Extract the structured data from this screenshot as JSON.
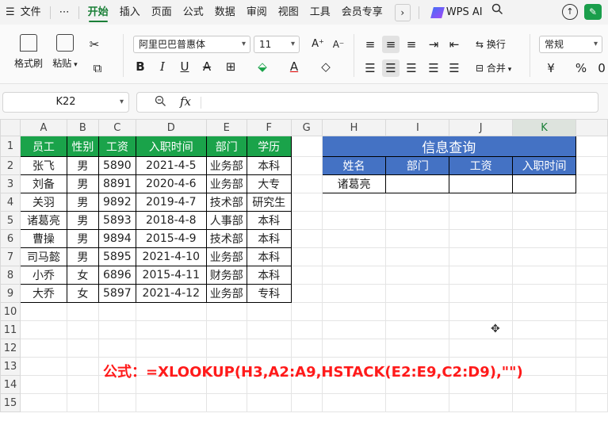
{
  "menu": {
    "hamburger": "☰",
    "file": "文件",
    "more": "⋯",
    "tabs": [
      "开始",
      "插入",
      "页面",
      "公式",
      "数据",
      "审阅",
      "视图",
      "工具",
      "会员专享"
    ],
    "active_tab": "开始",
    "chevron": "›",
    "wps_ai": "WPS AI"
  },
  "ribbon": {
    "format_painter": "格式刷",
    "paste": "粘贴",
    "font_name": "阿里巴巴普惠体",
    "font_size": "11",
    "bold": "B",
    "italic": "I",
    "underline": "U",
    "wrap": "换行",
    "merge": "合并",
    "number_format": "常规",
    "currency": "¥",
    "percent": "%"
  },
  "formula_bar": {
    "cell_ref": "K22",
    "fx": "fx",
    "content": ""
  },
  "sheet": {
    "columns": [
      "A",
      "B",
      "C",
      "D",
      "E",
      "F",
      "G",
      "H",
      "I",
      "J",
      "K"
    ],
    "selected_column": "K",
    "rows": [
      "1",
      "2",
      "3",
      "4",
      "5",
      "6",
      "7",
      "8",
      "9",
      "10",
      "11",
      "12",
      "13",
      "14",
      "15"
    ],
    "employee_headers": [
      "员工",
      "性别",
      "工资",
      "入职时间",
      "部门",
      "学历"
    ],
    "employees": [
      [
        "张飞",
        "男",
        "5890",
        "2021-4-5",
        "业务部",
        "本科"
      ],
      [
        "刘备",
        "男",
        "8891",
        "2020-4-6",
        "业务部",
        "大专"
      ],
      [
        "关羽",
        "男",
        "9892",
        "2019-4-7",
        "技术部",
        "研究生"
      ],
      [
        "诸葛亮",
        "男",
        "5893",
        "2018-4-8",
        "人事部",
        "本科"
      ],
      [
        "曹操",
        "男",
        "9894",
        "2015-4-9",
        "技术部",
        "本科"
      ],
      [
        "司马懿",
        "男",
        "5895",
        "2021-4-10",
        "业务部",
        "本科"
      ],
      [
        "小乔",
        "女",
        "6896",
        "2015-4-11",
        "财务部",
        "本科"
      ],
      [
        "大乔",
        "女",
        "5897",
        "2021-4-12",
        "业务部",
        "专科"
      ]
    ],
    "query_title": "信息查询",
    "query_headers": [
      "姓名",
      "部门",
      "工资",
      "入职时间"
    ],
    "query_values": [
      "诸葛亮",
      "",
      "",
      ""
    ]
  },
  "note": "公式：=XLOOKUP(H3,A2:A9,HSTACK(E2:E9,C2:D9),\"\")",
  "colors": {
    "accent_green": "#1aa34a",
    "query_blue": "#4472c4",
    "note_red": "#ff1a1a"
  }
}
